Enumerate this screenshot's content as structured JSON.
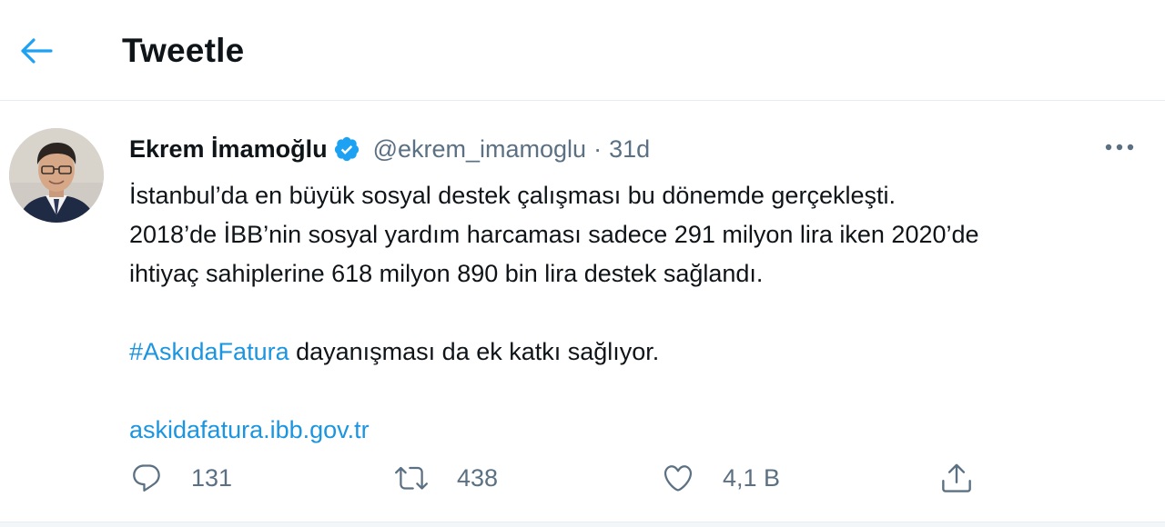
{
  "header": {
    "title": "Tweetle",
    "back_icon": "arrow-left-icon"
  },
  "tweet": {
    "author_name": "Ekrem İmamoğlu",
    "verified_icon": "verified-badge-icon",
    "handle": "@ekrem_imamoglu",
    "separator": "·",
    "time": "31d",
    "more_icon": "more-dots-icon",
    "text": {
      "line1": "İstanbul’da en büyük sosyal destek çalışması bu dönemde gerçekleşti.",
      "line2": "2018’de İBB’nin sosyal yardım harcaması sadece 291 milyon lira iken 2020’de",
      "line3": "ihtiyaç sahiplerine 618 milyon 890 bin lira destek sağlandı.",
      "hashtag": "#AskıdaFatura",
      "hashtag_rest": " dayanışması da ek katkı sağlıyor.",
      "link": "askidafatura.ibb.gov.tr"
    },
    "actions": {
      "reply": {
        "icon": "reply-icon",
        "count": "131"
      },
      "retweet": {
        "icon": "retweet-icon",
        "count": "438"
      },
      "like": {
        "icon": "heart-icon",
        "count": "4,1 B"
      },
      "share": {
        "icon": "share-icon"
      }
    }
  },
  "colors": {
    "accent": "#1da1f2",
    "link": "#1b95e0",
    "text": "#0f1419",
    "secondary": "#5b7083",
    "border": "#e6ecf0"
  }
}
